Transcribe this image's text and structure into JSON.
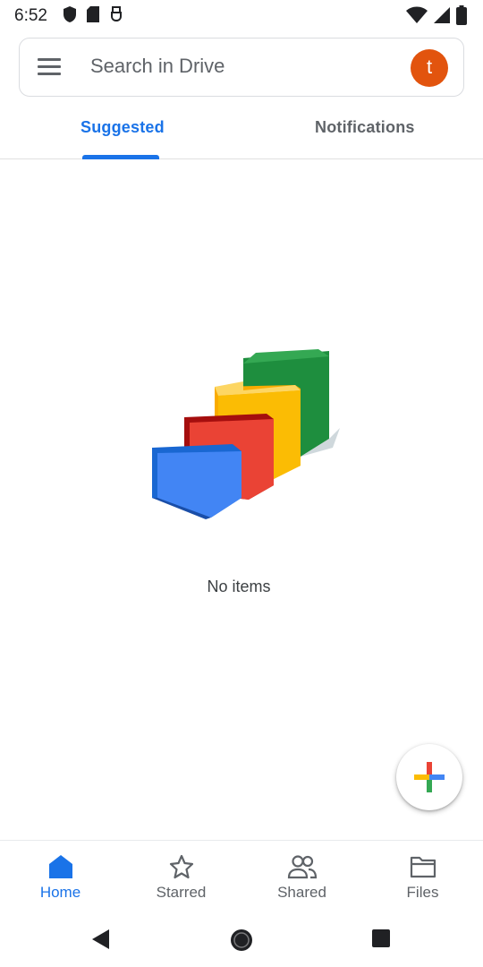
{
  "status_bar": {
    "time": "6:52",
    "left_icons": [
      "shield-icon",
      "sd-card-icon",
      "usb-icon"
    ],
    "right_icons": [
      "wifi-icon",
      "signal-icon",
      "battery-icon"
    ]
  },
  "search": {
    "placeholder": "Search in Drive",
    "avatar_initial": "t",
    "avatar_color": "#e2540e"
  },
  "tabs": [
    {
      "label": "Suggested",
      "active": true
    },
    {
      "label": "Notifications",
      "active": false
    }
  ],
  "empty_state": {
    "icon": "folders-illustration",
    "message": "No items"
  },
  "fab": {
    "icon": "plus-icon"
  },
  "bottom_nav": [
    {
      "label": "Home",
      "icon": "home-icon",
      "active": true
    },
    {
      "label": "Starred",
      "icon": "star-icon",
      "active": false
    },
    {
      "label": "Shared",
      "icon": "people-icon",
      "active": false
    },
    {
      "label": "Files",
      "icon": "folder-icon",
      "active": false
    }
  ],
  "system_nav": [
    "back-icon",
    "home-circle-icon",
    "recents-icon"
  ],
  "colors": {
    "accent": "#1a73e8",
    "google_blue": "#4285f4",
    "google_red": "#ea4335",
    "google_yellow": "#fbbc04",
    "google_green": "#34a853"
  }
}
